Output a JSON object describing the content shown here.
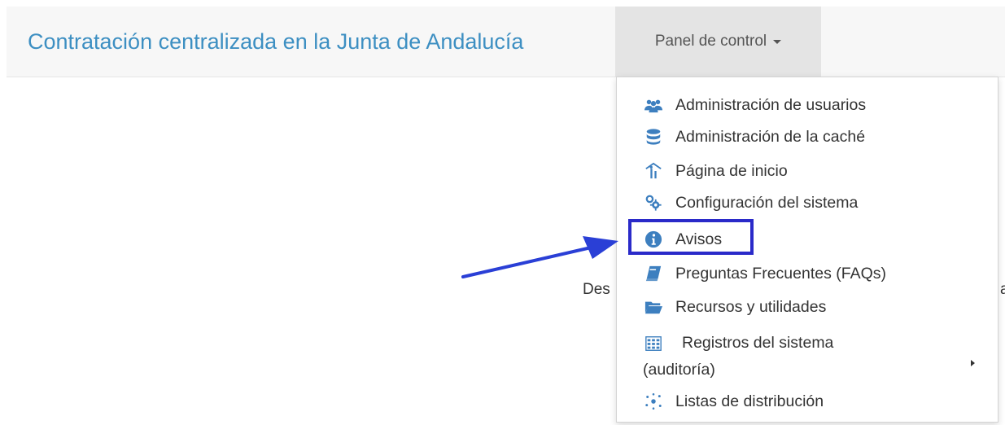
{
  "header": {
    "brand": "Contratación centralizada en la Junta de Andalucía",
    "nav_label": "Panel de control"
  },
  "background": {
    "text_left": "Des",
    "text_right": "a"
  },
  "menu": {
    "items": [
      {
        "label": "Administración de usuarios",
        "icon": "users-icon"
      },
      {
        "label": "Administración de la caché",
        "icon": "database-icon"
      },
      {
        "label": "Página de inicio",
        "icon": "home-tree-icon"
      },
      {
        "label": "Configuración del sistema",
        "icon": "gears-icon"
      },
      {
        "label": "Avisos",
        "icon": "info-icon"
      },
      {
        "label": "Preguntas Frecuentes (FAQs)",
        "icon": "book-icon"
      },
      {
        "label": "Recursos y utilidades",
        "icon": "folder-open-icon"
      },
      {
        "label_line1": "Registros del sistema",
        "label_line2": "(auditoría)",
        "icon": "registry-grid-icon"
      },
      {
        "label": "Listas de distribución",
        "icon": "network-icon"
      }
    ]
  },
  "colors": {
    "brand": "#3d8fc2",
    "icon": "#3d7fbf",
    "highlight": "#2a2ac9",
    "arrow": "#2a3fd6"
  }
}
